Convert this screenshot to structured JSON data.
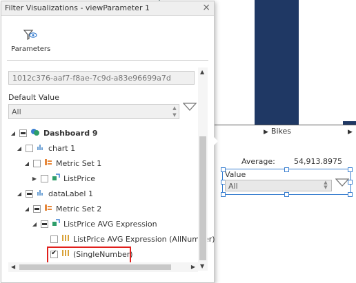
{
  "panel": {
    "title": "Filter Visualizations - viewParameter 1",
    "close_label": "×",
    "parameters_label": "Parameters",
    "id_value": "1012c376-aaf7-f8ae-7c9d-a83e96699a7d",
    "default_value_label": "Default Value",
    "default_value_selected": "All"
  },
  "tree": [
    {
      "label": "Dashboard 9",
      "icon": "dashboard-icon",
      "state": "indeterminate",
      "expanded": true,
      "bold": true
    },
    {
      "label": "chart 1",
      "icon": "bar-chart-icon",
      "state": "unchecked",
      "expanded": true
    },
    {
      "label": "Metric Set 1",
      "icon": "metric-set-icon",
      "state": "unchecked",
      "expanded": true
    },
    {
      "label": "ListPrice",
      "icon": "metric-icon",
      "state": "unchecked",
      "expanded": false
    },
    {
      "label": "dataLabel 1",
      "icon": "bar-chart-icon",
      "state": "indeterminate",
      "expanded": true
    },
    {
      "label": "Metric Set 2",
      "icon": "metric-set-icon",
      "state": "indeterminate",
      "expanded": true
    },
    {
      "label": "ListPrice AVG Expression",
      "icon": "metric-icon",
      "state": "indeterminate",
      "expanded": true
    },
    {
      "label": "ListPrice AVG Expression (AllNumber)",
      "icon": "column-icon",
      "state": "unchecked"
    },
    {
      "label": "(SingleNumber)",
      "icon": "column-icon",
      "state": "checked"
    }
  ],
  "background": {
    "category_label": "Bikes",
    "average_label": "Average:",
    "average_value": "54,913.8975",
    "widget_label": "Value",
    "widget_selected": "All"
  },
  "colors": {
    "bar": "#1f3864",
    "highlight": "#e0201c",
    "selection": "#3a7fd0"
  }
}
